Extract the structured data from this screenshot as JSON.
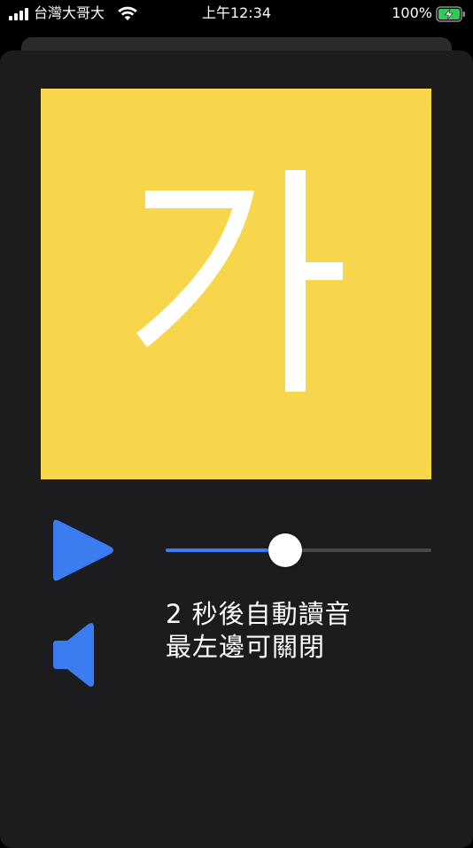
{
  "status_bar": {
    "carrier": "台灣大哥大",
    "time": "上午12:34",
    "battery_percent": "100%"
  },
  "card": {
    "character": "가",
    "background_color": "#f7d64b"
  },
  "player": {
    "slider_value_fraction": 0.45,
    "accent_color": "#3b7cf0",
    "hint_line1": "2 秒後自動讀音",
    "hint_line2": "最左邊可關閉"
  },
  "icons": {
    "play": "play-icon",
    "speaker": "speaker-icon",
    "signal": "signal-icon",
    "wifi": "wifi-icon",
    "battery": "battery-charging-icon"
  }
}
